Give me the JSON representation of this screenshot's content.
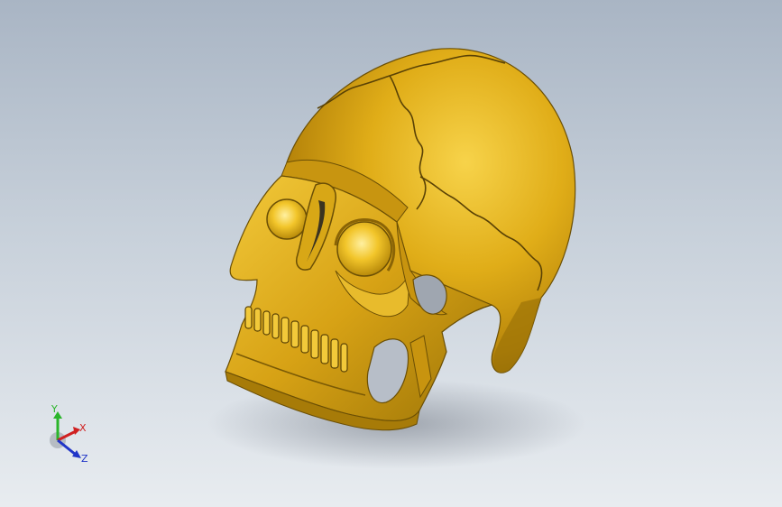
{
  "viewport": {
    "background_top": "#a9b5c4",
    "background_bottom": "#e8ecf0"
  },
  "model": {
    "name": "skull-model",
    "material_color": "#d4a017"
  },
  "triad": {
    "y_label": "Y",
    "x_label": "X",
    "z_label": "Z",
    "y_color": "#2ab52a",
    "x_color": "#d02020",
    "z_color": "#2035c8"
  }
}
